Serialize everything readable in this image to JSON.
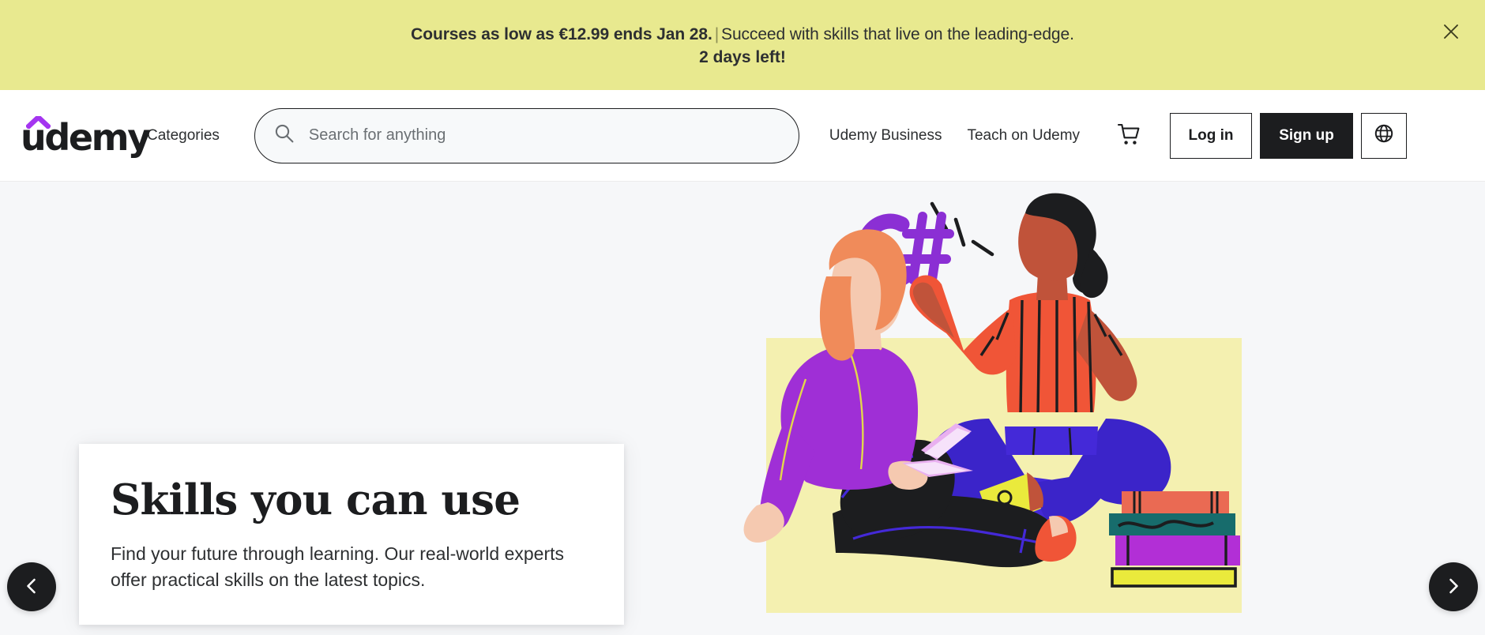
{
  "promo_banner": {
    "highlight": "Courses as low as €12.99 ends Jan 28.",
    "separator": "|",
    "message": "Succeed with skills that live on the leading-edge.",
    "countdown": "2 days left!",
    "close_icon": "close-icon",
    "background_color": "#e8e98f",
    "text_color": "#2d2f31"
  },
  "header": {
    "logo_text": "udemy",
    "logo_accent_color": "#a435f0",
    "categories_label": "Categories",
    "search": {
      "placeholder": "Search for anything",
      "value": "",
      "icon": "search-icon"
    },
    "links": [
      {
        "label": "Udemy Business"
      },
      {
        "label": "Teach on Udemy"
      }
    ],
    "cart_icon": "shopping-cart-icon",
    "login_label": "Log in",
    "signup_label": "Sign up",
    "language_icon": "globe-icon"
  },
  "hero": {
    "title": "Skills you can use",
    "subtitle": "Find your future through learning. Our real-world experts offer practical skills on the latest topics.",
    "prev_arrow_icon": "chevron-left-icon",
    "next_arrow_icon": "chevron-right-icon",
    "background_color": "#f6f7f9",
    "illustration": {
      "name": "two-people-learning-illustration",
      "badge_text": "C#",
      "badge_color": "#8b2fd4",
      "backdrop_color": "#f4f0b0",
      "books": [
        "#ea6a53",
        "#176c6c",
        "#b22fd6",
        "#eaea3c"
      ]
    }
  }
}
